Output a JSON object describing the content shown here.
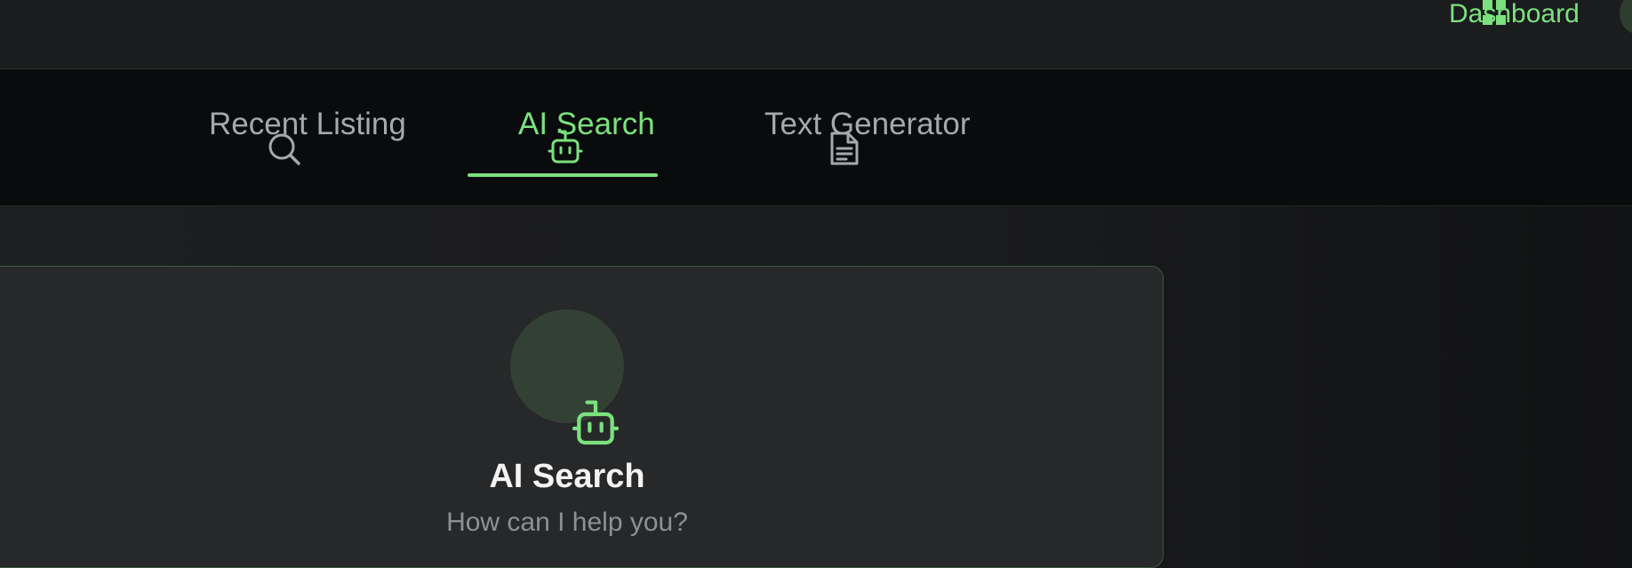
{
  "header": {
    "dashboard_label": "Dashboard",
    "dashboard_icon": "dashboard-icon",
    "accent_color": "#7be17d"
  },
  "tabs": [
    {
      "label": "Recent Listing",
      "icon": "search-icon",
      "active": false
    },
    {
      "label": "AI Search",
      "icon": "robot-icon",
      "active": true
    },
    {
      "label": "Text Generator",
      "icon": "document-icon",
      "active": false
    }
  ],
  "main": {
    "title": "AI Search",
    "subtitle": "How can I help you?",
    "icon": "robot-icon"
  }
}
